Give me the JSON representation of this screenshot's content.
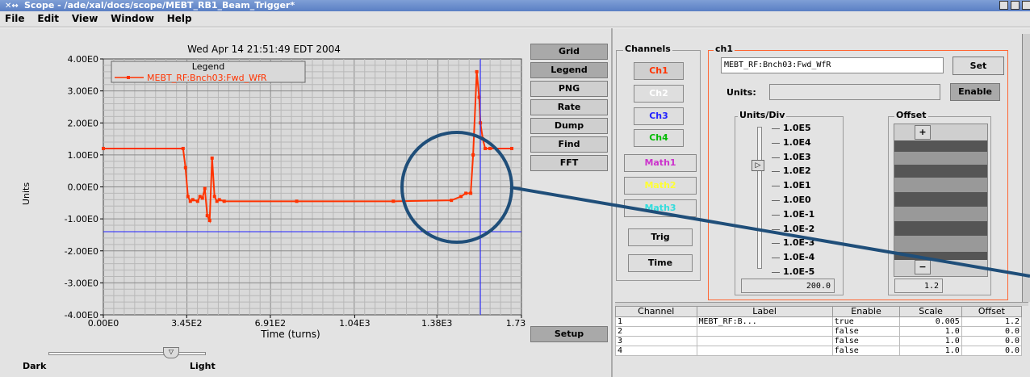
{
  "window": {
    "title": "Scope - /ade/xal/docs/scope/MEBT_RB1_Beam_Trigger*"
  },
  "menu": [
    "File",
    "Edit",
    "View",
    "Window",
    "Help"
  ],
  "plot": {
    "timestamp": "Wed Apr 14 21:51:49 EDT 2004",
    "legend_title": "Legend",
    "legend_entry": "MEBT_RF:Bnch03:Fwd_WfR",
    "ylabel": "Units",
    "xlabel": "Time (turns)",
    "yticks": [
      "4.00E0",
      "3.00E0",
      "2.00E0",
      "1.00E0",
      "0.00E0",
      "-1.00E0",
      "-2.00E0",
      "-3.00E0",
      "-4.00E0"
    ],
    "xticks": [
      "0.00E0",
      "3.45E2",
      "6.91E2",
      "1.04E3",
      "1.38E3",
      "1.73E3"
    ],
    "trace_color": "#ff3300"
  },
  "chart_data": {
    "type": "line",
    "series": [
      {
        "name": "MEBT_RF:Bnch03:Fwd_WfR",
        "x": [
          0,
          330,
          340,
          350,
          360,
          370,
          390,
          400,
          410,
          420,
          430,
          440,
          450,
          460,
          470,
          480,
          500,
          800,
          1200,
          1440,
          1480,
          1500,
          1520,
          1530,
          1545,
          1555,
          1560,
          1570,
          1580,
          1600,
          1690
        ],
        "y": [
          1.2,
          1.2,
          0.6,
          -0.3,
          -0.45,
          -0.4,
          -0.45,
          -0.3,
          -0.35,
          -0.05,
          -0.9,
          -1.05,
          0.9,
          -0.3,
          -0.45,
          -0.4,
          -0.45,
          -0.45,
          -0.45,
          -0.42,
          -0.3,
          -0.2,
          -0.2,
          1.0,
          3.6,
          2.8,
          2.0,
          1.5,
          1.2,
          1.2,
          1.2
        ]
      }
    ],
    "xlim": [
      0,
      1730
    ],
    "ylim": [
      -4,
      4
    ],
    "cursor": {
      "x": 1560,
      "y": -1.4
    },
    "xlabel": "Time (turns)",
    "ylabel": "Units",
    "grid": true,
    "legend": "top-left"
  },
  "buttons": {
    "grid": "Grid",
    "legend": "Legend",
    "png": "PNG",
    "rate": "Rate",
    "dump": "Dump",
    "find": "Find",
    "fft": "FFT",
    "setup": "Setup"
  },
  "bottom": {
    "dark": "Dark",
    "light": "Light"
  },
  "channels": {
    "title": "Channels",
    "items": [
      {
        "label": "Ch1",
        "color": "#ff3300"
      },
      {
        "label": "Ch2",
        "color": "#ffffff"
      },
      {
        "label": "Ch3",
        "color": "#2222ff"
      },
      {
        "label": "Ch4",
        "color": "#00bb00"
      },
      {
        "label": "Math1",
        "color": "#cc33cc"
      },
      {
        "label": "Math2",
        "color": "#ffff33"
      },
      {
        "label": "Math3",
        "color": "#33dddd"
      }
    ],
    "trig": "Trig",
    "time": "Time"
  },
  "ch1": {
    "title": "ch1",
    "signal": "MEBT_RF:Bnch03:Fwd_WfR",
    "set": "Set",
    "units_label": "Units:",
    "enable": "Enable",
    "units_div_title": "Units/Div",
    "div_labels": [
      "1.0E5",
      "1.0E4",
      "1.0E3",
      "1.0E2",
      "1.0E1",
      "1.0E0",
      "1.0E-1",
      "1.0E-2",
      "1.0E-3",
      "1.0E-4",
      "1.0E-5"
    ],
    "units_div_value": "200.0",
    "offset_title": "Offset",
    "plus": "+",
    "minus": "−",
    "offset_value": "1.2"
  },
  "table": {
    "headers": [
      "Channel",
      "Label",
      "Enable",
      "Scale",
      "Offset"
    ],
    "rows": [
      [
        "1",
        "MEBT_RF:B...",
        "true",
        "0.005",
        "1.2"
      ],
      [
        "2",
        "",
        "false",
        "1.0",
        "0.0"
      ],
      [
        "3",
        "",
        "false",
        "1.0",
        "0.0"
      ],
      [
        "4",
        "",
        "false",
        "1.0",
        "0.0"
      ]
    ]
  }
}
